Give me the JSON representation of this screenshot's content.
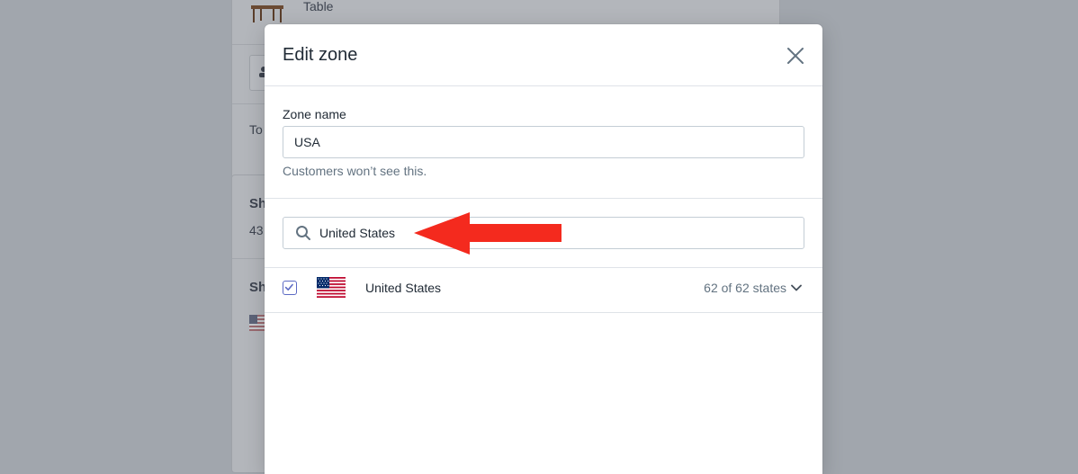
{
  "background": {
    "product_name": "Table",
    "footer_text": "To",
    "section_heading_1": "Sh",
    "section_text_1": "43",
    "section_heading_2": "Sh"
  },
  "modal": {
    "title": "Edit zone",
    "zone_name_label": "Zone name",
    "zone_name_value": "USA",
    "zone_name_help": "Customers won’t see this.",
    "search_value": "United States",
    "country": {
      "name": "United States",
      "checked": true,
      "states_summary": "62 of 62 states"
    }
  },
  "icons": {
    "close": "close-icon",
    "search": "search-icon",
    "checkmark": "checkmark-icon",
    "chevron": "chevron-down-icon",
    "flag": "us-flag-icon"
  },
  "colors": {
    "overlay": "#a1a6ad",
    "checkbox_accent": "#5c6ac4",
    "annotation_arrow": "#f42a1e",
    "muted_text": "#637381"
  }
}
